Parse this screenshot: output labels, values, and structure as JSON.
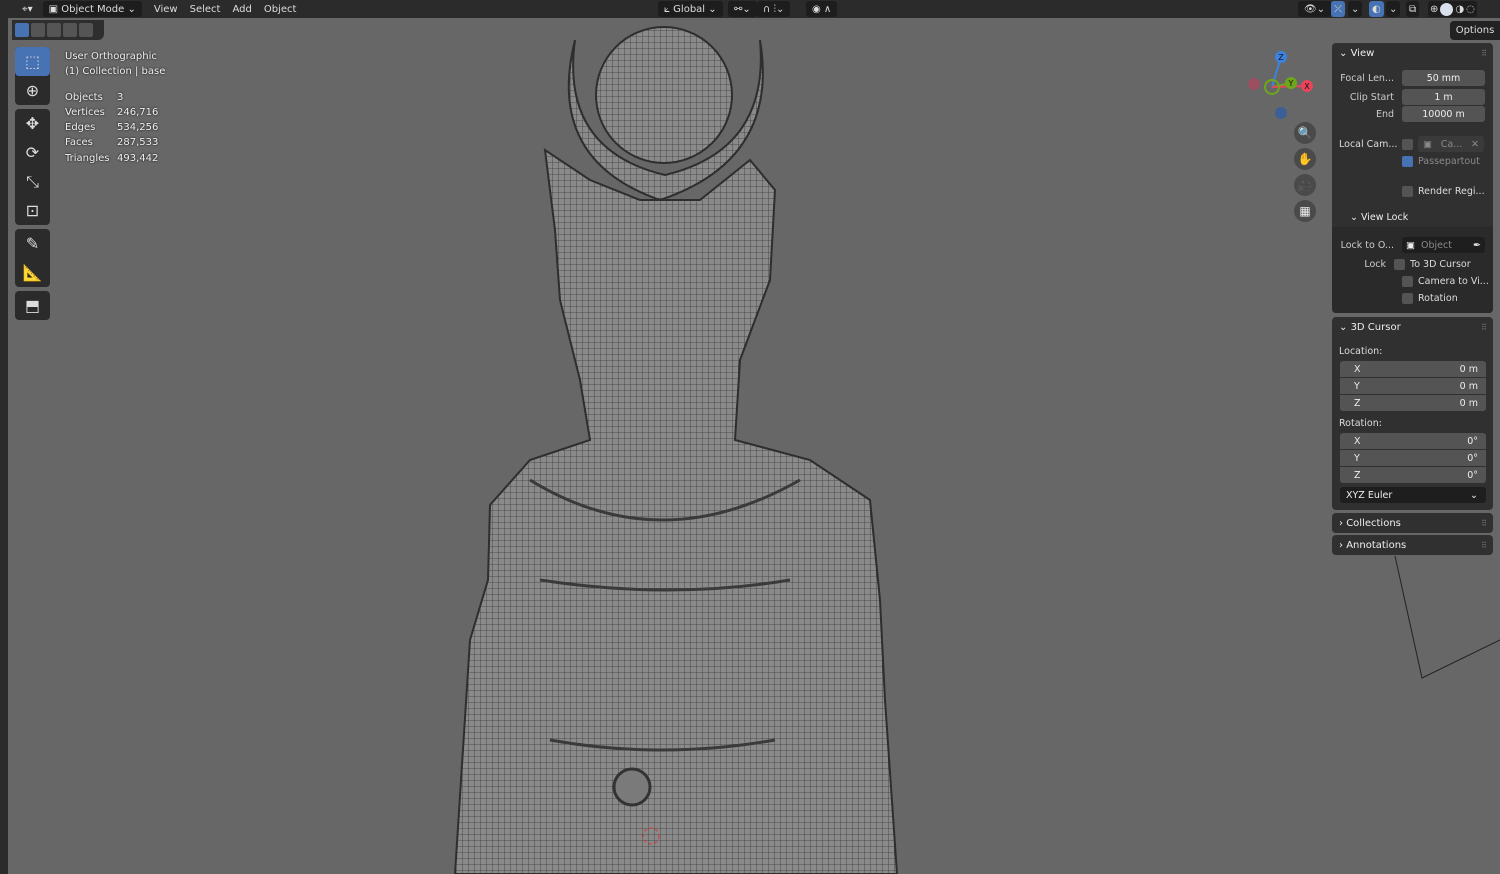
{
  "header": {
    "editor_icon": "editor-type-3d-viewport-icon",
    "mode": "Object Mode",
    "menus": [
      "View",
      "Select",
      "Add",
      "Object"
    ],
    "transform_orientation": "Global"
  },
  "overlay": {
    "view_name": "User Orthographic",
    "collection": "(1) Collection | base",
    "stats": [
      {
        "label": "Objects",
        "value": "3"
      },
      {
        "label": "Vertices",
        "value": "246,716"
      },
      {
        "label": "Edges",
        "value": "534,256"
      },
      {
        "label": "Faces",
        "value": "287,533"
      },
      {
        "label": "Triangles",
        "value": "493,442"
      }
    ]
  },
  "gizmo": {
    "x": "X",
    "y": "Y",
    "z": "Z",
    "x_color": "#e8445a",
    "y_color": "#6ea61d",
    "z_color": "#3c82e0"
  },
  "sidebar": {
    "options_tab": "Options",
    "view": {
      "title": "View",
      "focal_label": "Focal Len...",
      "focal": "50 mm",
      "clip_start_label": "Clip Start",
      "clip_start": "1 m",
      "end_label": "End",
      "end": "10000 m",
      "local_cam_label": "Local Cam...",
      "local_cam_value": "Ca...",
      "passepartout": "Passepartout",
      "passepartout_checked": true,
      "render_region": "Render Regi..."
    },
    "view_lock": {
      "title": "View Lock",
      "lock_to_label": "Lock to O...",
      "lock_to_value": "Object",
      "lock_label": "Lock",
      "to_cursor": "To 3D Cursor",
      "camera_to_view": "Camera to Vi...",
      "rotation": "Rotation"
    },
    "cursor": {
      "title": "3D Cursor",
      "location_label": "Location:",
      "location": [
        {
          "axis": "X",
          "value": "0 m"
        },
        {
          "axis": "Y",
          "value": "0 m"
        },
        {
          "axis": "Z",
          "value": "0 m"
        }
      ],
      "rotation_label": "Rotation:",
      "rotation": [
        {
          "axis": "X",
          "value": "0°"
        },
        {
          "axis": "Y",
          "value": "0°"
        },
        {
          "axis": "Z",
          "value": "0°"
        }
      ],
      "rotation_mode": "XYZ Euler"
    },
    "collections": "Collections",
    "annotations": "Annotations"
  }
}
